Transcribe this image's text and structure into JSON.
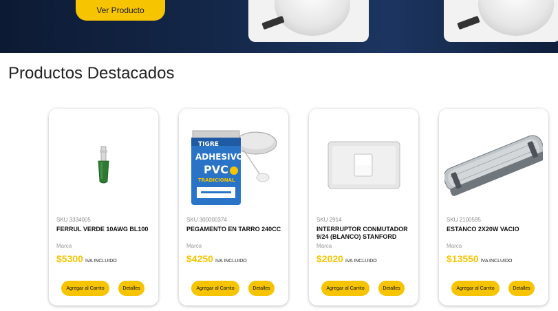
{
  "hero": {
    "button_label": "Ver Producto"
  },
  "section": {
    "title": "Productos Destacados"
  },
  "colors": {
    "accent": "#f6c400",
    "hero_bg": "#14284a"
  },
  "products": [
    {
      "sku": "SKU 3334005",
      "name": "FERRUL VERDE 10AWG BL100",
      "brand": "Marca",
      "price": "$5300",
      "tax": "IVA INCLUIDO",
      "cart_label": "Agregar al Carrito",
      "details_label": "Detalles",
      "icon": "ferrule-icon"
    },
    {
      "sku": "SKU 300000374",
      "name": "PEGAMENTO EN TARRO 240CC",
      "brand": "Marca",
      "price": "$4250",
      "tax": "IVA INCLUIDO",
      "cart_label": "Agregar al Carrito",
      "details_label": "Detalles",
      "icon": "glue-can-icon",
      "label_brand": "TIGRE",
      "label_line1": "ADHESIVO",
      "label_line2": "PVC",
      "label_line3": "TRADICIONAL"
    },
    {
      "sku": "SKU 2914",
      "name": "INTERRUPTOR CONMUTADOR 9/24 (BLANCO) STANFORD",
      "brand": "Marca",
      "price": "$2020",
      "tax": "IVA INCLUIDO",
      "cart_label": "Agregar al Carrito",
      "details_label": "Detalles",
      "icon": "switch-icon"
    },
    {
      "sku": "SKU 2100595",
      "name": "ESTANCO 2X20W VACIO",
      "brand": "Marca",
      "price": "$13550",
      "tax": "IVA INCLUIDO",
      "cart_label": "Agregar al Carrito",
      "details_label": "Detalles",
      "icon": "light-fixture-icon"
    }
  ]
}
